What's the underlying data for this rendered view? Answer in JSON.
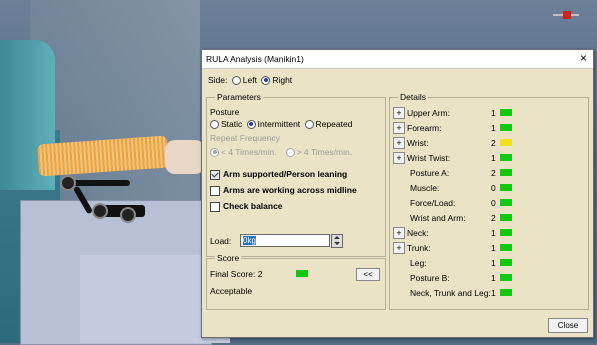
{
  "colors": {
    "green": "#10c810",
    "yellow": "#f0e020"
  },
  "dialog": {
    "title": "RULA Analysis (Manikin1)",
    "close_icon": "×",
    "side": {
      "label": "Side:",
      "options": [
        "Left",
        "Right"
      ],
      "selected": "Right"
    },
    "parameters": {
      "title": "Parameters",
      "posture_label": "Posture",
      "posture_options": [
        "Static",
        "Intermittent",
        "Repeated"
      ],
      "posture_selected": "Intermittent",
      "repeat_label": "Repeat Frequency",
      "repeat_options": [
        "< 4 Times/min.",
        "> 4 Times/min."
      ],
      "repeat_selected": "< 4 Times/min.",
      "checks": [
        {
          "label": "Arm supported/Person leaning",
          "checked": true
        },
        {
          "label": "Arms are working across midline",
          "checked": false
        },
        {
          "label": "Check balance",
          "checked": false
        }
      ],
      "load_label": "Load:",
      "load_value": "0kg"
    },
    "score": {
      "title": "Score",
      "final_score": "Final Score: 2",
      "final_color": "green",
      "verdict": "Acceptable",
      "collapse_button": "<<"
    },
    "details": {
      "title": "Details",
      "rows": [
        {
          "label": "Upper Arm:",
          "value": "1",
          "color": "green",
          "expandable": true
        },
        {
          "label": "Forearm:",
          "value": "1",
          "color": "green",
          "expandable": true
        },
        {
          "label": "Wrist:",
          "value": "2",
          "color": "yellow",
          "expandable": true
        },
        {
          "label": "Wrist Twist:",
          "value": "1",
          "color": "green",
          "expandable": true
        },
        {
          "label": "Posture A:",
          "value": "2",
          "color": "green",
          "expandable": false
        },
        {
          "label": "Muscle:",
          "value": "0",
          "color": "green",
          "expandable": false
        },
        {
          "label": "Force/Load:",
          "value": "0",
          "color": "green",
          "expandable": false
        },
        {
          "label": "Wrist and Arm:",
          "value": "2",
          "color": "green",
          "expandable": false
        },
        {
          "label": "Neck:",
          "value": "1",
          "color": "green",
          "expandable": true
        },
        {
          "label": "Trunk:",
          "value": "1",
          "color": "green",
          "expandable": true
        },
        {
          "label": "Leg:",
          "value": "1",
          "color": "green",
          "expandable": false
        },
        {
          "label": "Posture B:",
          "value": "1",
          "color": "green",
          "expandable": false
        },
        {
          "label": "Neck, Trunk and Leg:",
          "value": "1",
          "color": "green",
          "expandable": false
        }
      ]
    },
    "close_button": "Close"
  }
}
